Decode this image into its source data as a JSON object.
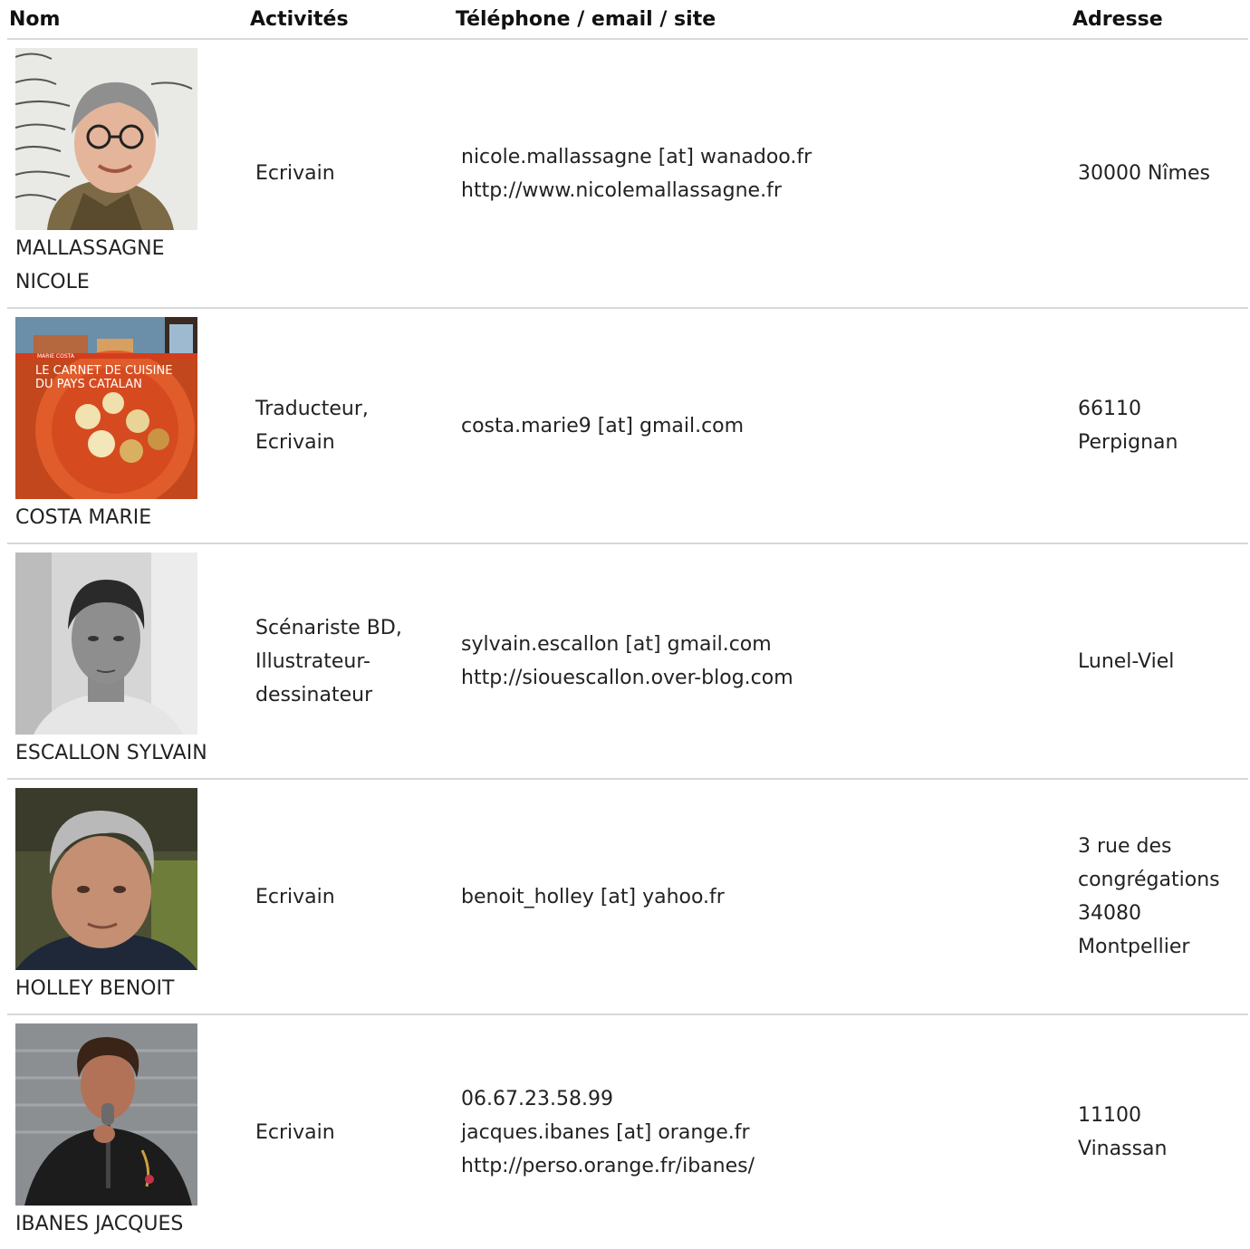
{
  "headers": {
    "name": "Nom",
    "activities": "Activités",
    "contact": "Téléphone / email / site",
    "address": "Adresse"
  },
  "rows": [
    {
      "name_line1": "MALLASSAGNE",
      "name_line2": "NICOLE",
      "activity_line1": "Ecrivain",
      "activity_line2": "",
      "activity_line3": "",
      "contact_line1": "nicole.mallassagne [at] wanadoo.fr",
      "contact_line2": "http://www.nicolemallassagne.fr",
      "contact_line3": "",
      "address_line1": "30000 Nîmes",
      "address_line2": "",
      "address_line3": "",
      "address_line4": ""
    },
    {
      "name_line1": "COSTA MARIE",
      "name_line2": "",
      "photo_text_author": "MARIE COSTA",
      "photo_text_title1": "LE CARNET DE CUISINE",
      "photo_text_title2": "DU PAYS CATALAN",
      "activity_line1": "Traducteur,",
      "activity_line2": "Ecrivain",
      "activity_line3": "",
      "contact_line1": "costa.marie9 [at] gmail.com",
      "contact_line2": "",
      "contact_line3": "",
      "address_line1": "66110",
      "address_line2": "Perpignan",
      "address_line3": "",
      "address_line4": ""
    },
    {
      "name_line1": "ESCALLON SYLVAIN",
      "name_line2": "",
      "activity_line1": "Scénariste BD,",
      "activity_line2": "Illustrateur-",
      "activity_line3": "dessinateur",
      "contact_line1": "sylvain.escallon [at] gmail.com",
      "contact_line2": "http://siouescallon.over-blog.com",
      "contact_line3": "",
      "address_line1": "Lunel-Viel",
      "address_line2": "",
      "address_line3": "",
      "address_line4": ""
    },
    {
      "name_line1": "HOLLEY BENOIT",
      "name_line2": "",
      "activity_line1": "Ecrivain",
      "activity_line2": "",
      "activity_line3": "",
      "contact_line1": "benoit_holley [at] yahoo.fr",
      "contact_line2": "",
      "contact_line3": "",
      "address_line1": "3 rue des",
      "address_line2": "congrégations",
      "address_line3": "34080",
      "address_line4": "Montpellier"
    },
    {
      "name_line1": "IBANES JACQUES",
      "name_line2": "",
      "activity_line1": "Ecrivain",
      "activity_line2": "",
      "activity_line3": "",
      "contact_line1": "06.67.23.58.99",
      "contact_line2": "jacques.ibanes [at] orange.fr",
      "contact_line3": "http://perso.orange.fr/ibanes/",
      "address_line1": "11100",
      "address_line2": "Vinassan",
      "address_line3": "",
      "address_line4": ""
    }
  ]
}
